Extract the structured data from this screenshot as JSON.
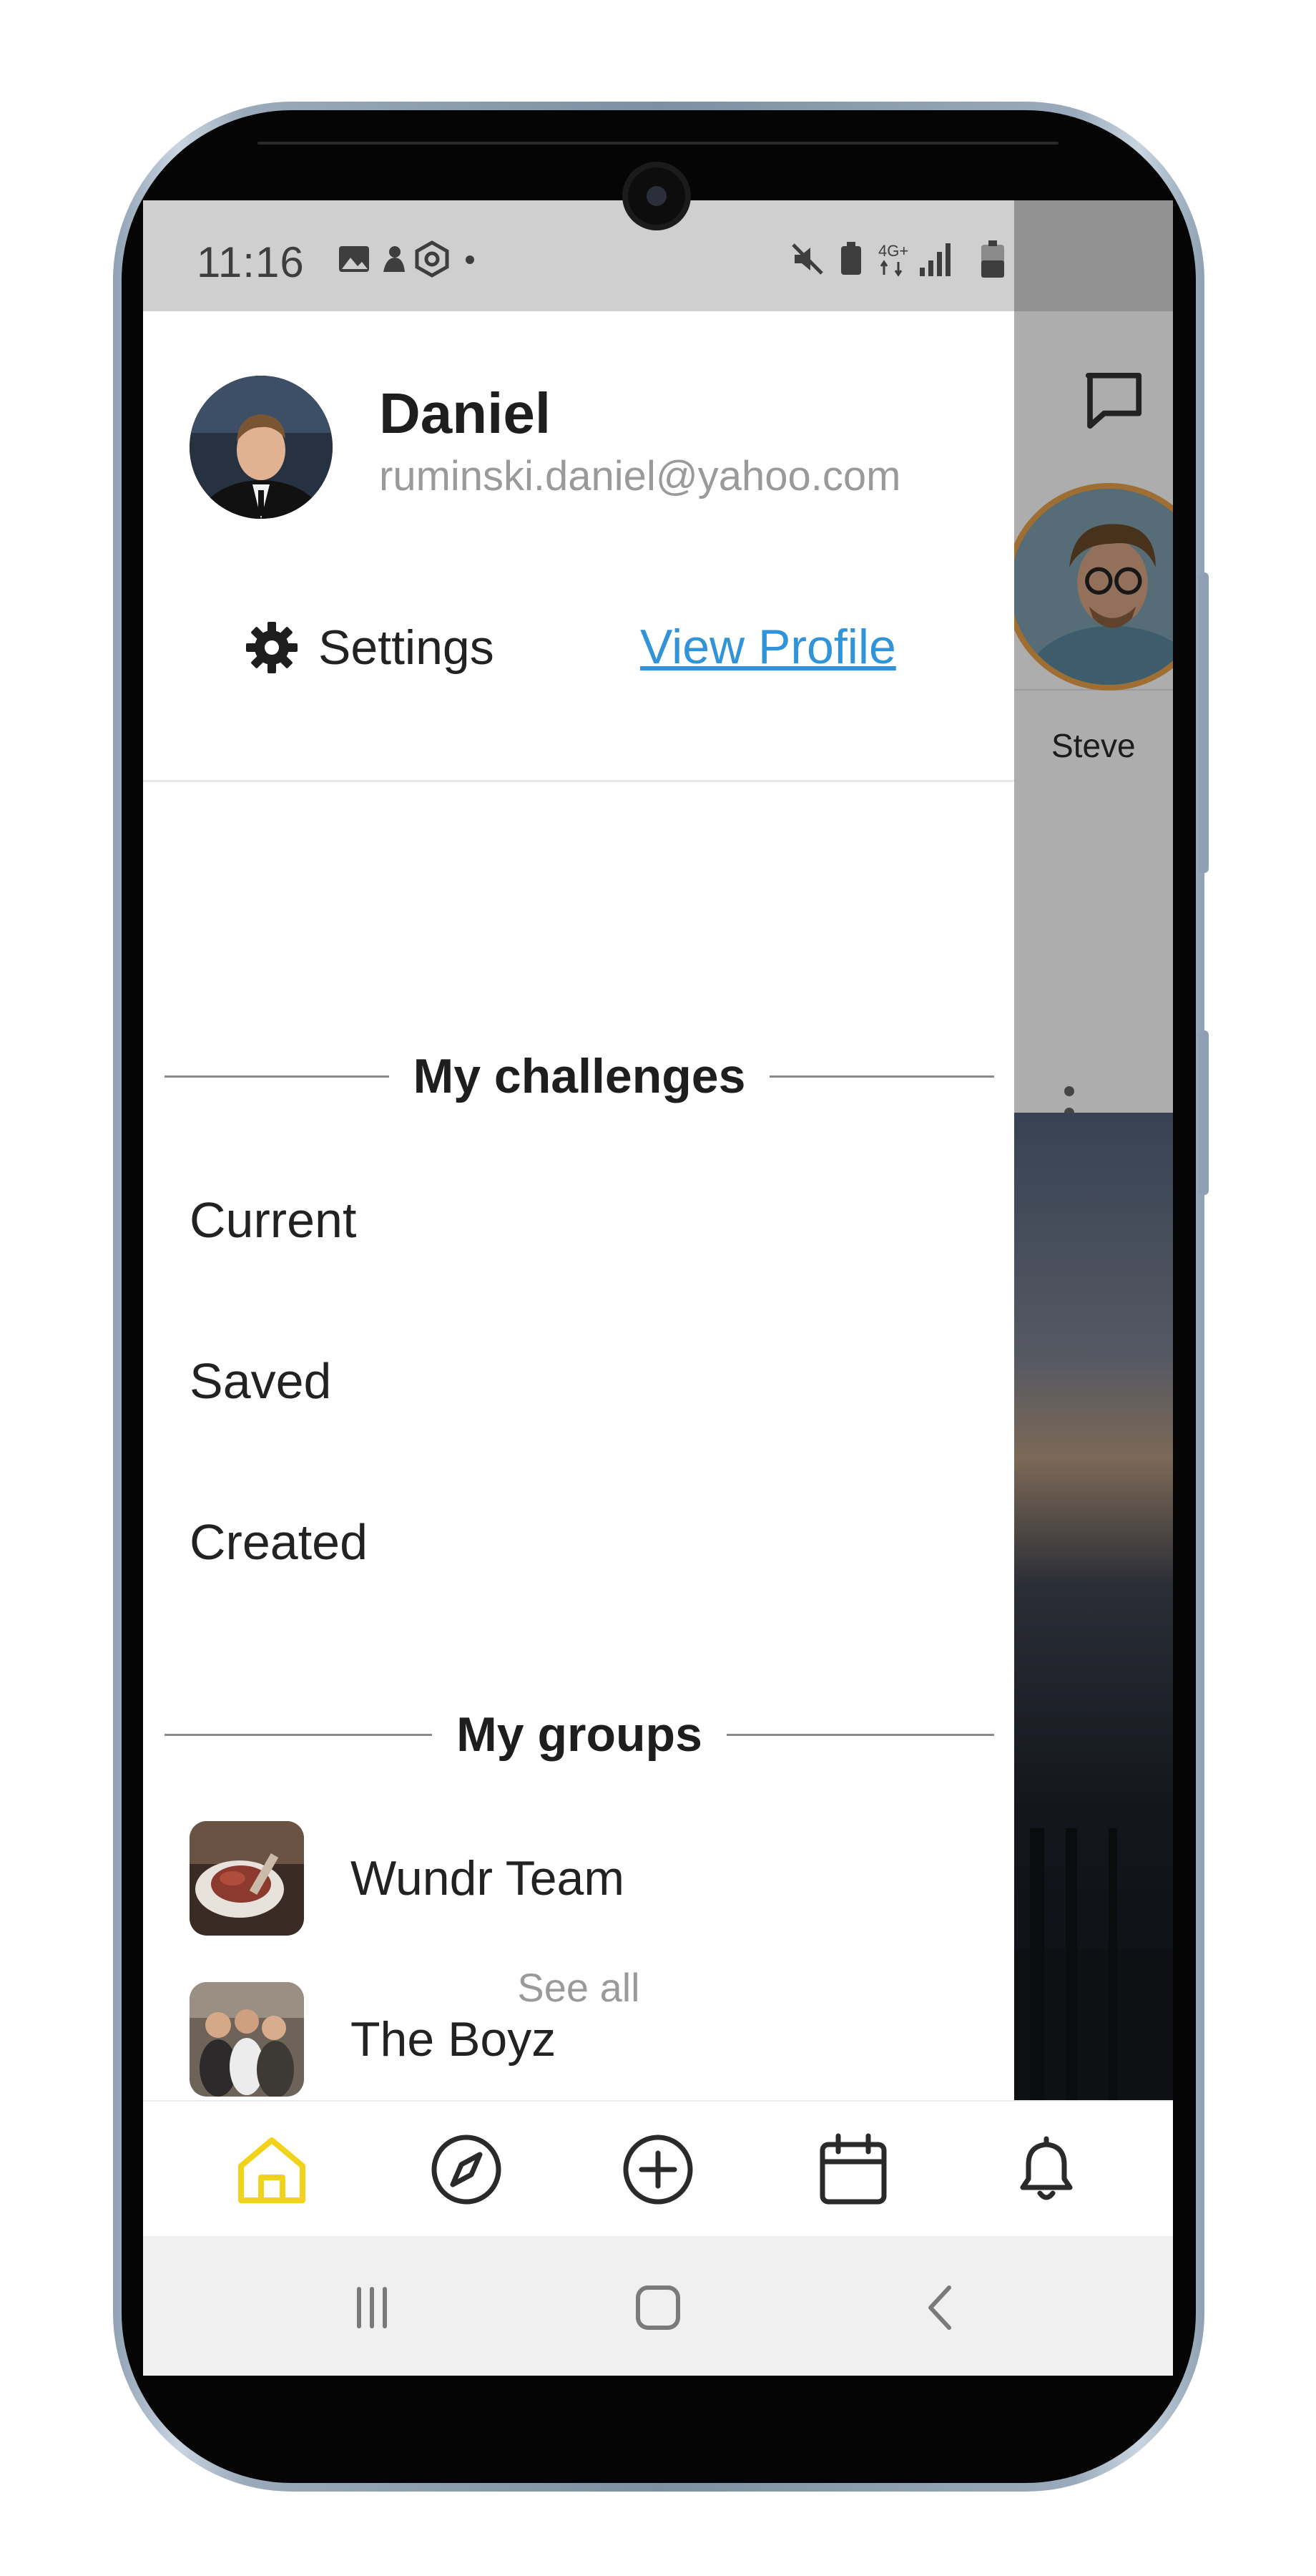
{
  "status_bar": {
    "time": "11:16"
  },
  "profile": {
    "name": "Daniel",
    "email": "ruminski.daniel@yahoo.com",
    "settings_label": "Settings",
    "view_profile_label": "View Profile"
  },
  "challenges": {
    "title": "My challenges",
    "items": [
      {
        "label": "Current"
      },
      {
        "label": "Saved"
      },
      {
        "label": "Created"
      }
    ]
  },
  "groups": {
    "title": "My groups",
    "items": [
      {
        "label": "Wundr Team"
      },
      {
        "label": "The Boyz"
      }
    ],
    "see_all_label": "See all"
  },
  "background": {
    "story_name": "Steve"
  },
  "bottom_nav": {
    "active": "home",
    "items": [
      "home-icon",
      "compass-icon",
      "add-circle-icon",
      "calendar-icon",
      "bell-icon"
    ],
    "active_color": "#f2d31b"
  },
  "colors": {
    "link": "#3294d8",
    "story_ring": "#e9a24a"
  }
}
